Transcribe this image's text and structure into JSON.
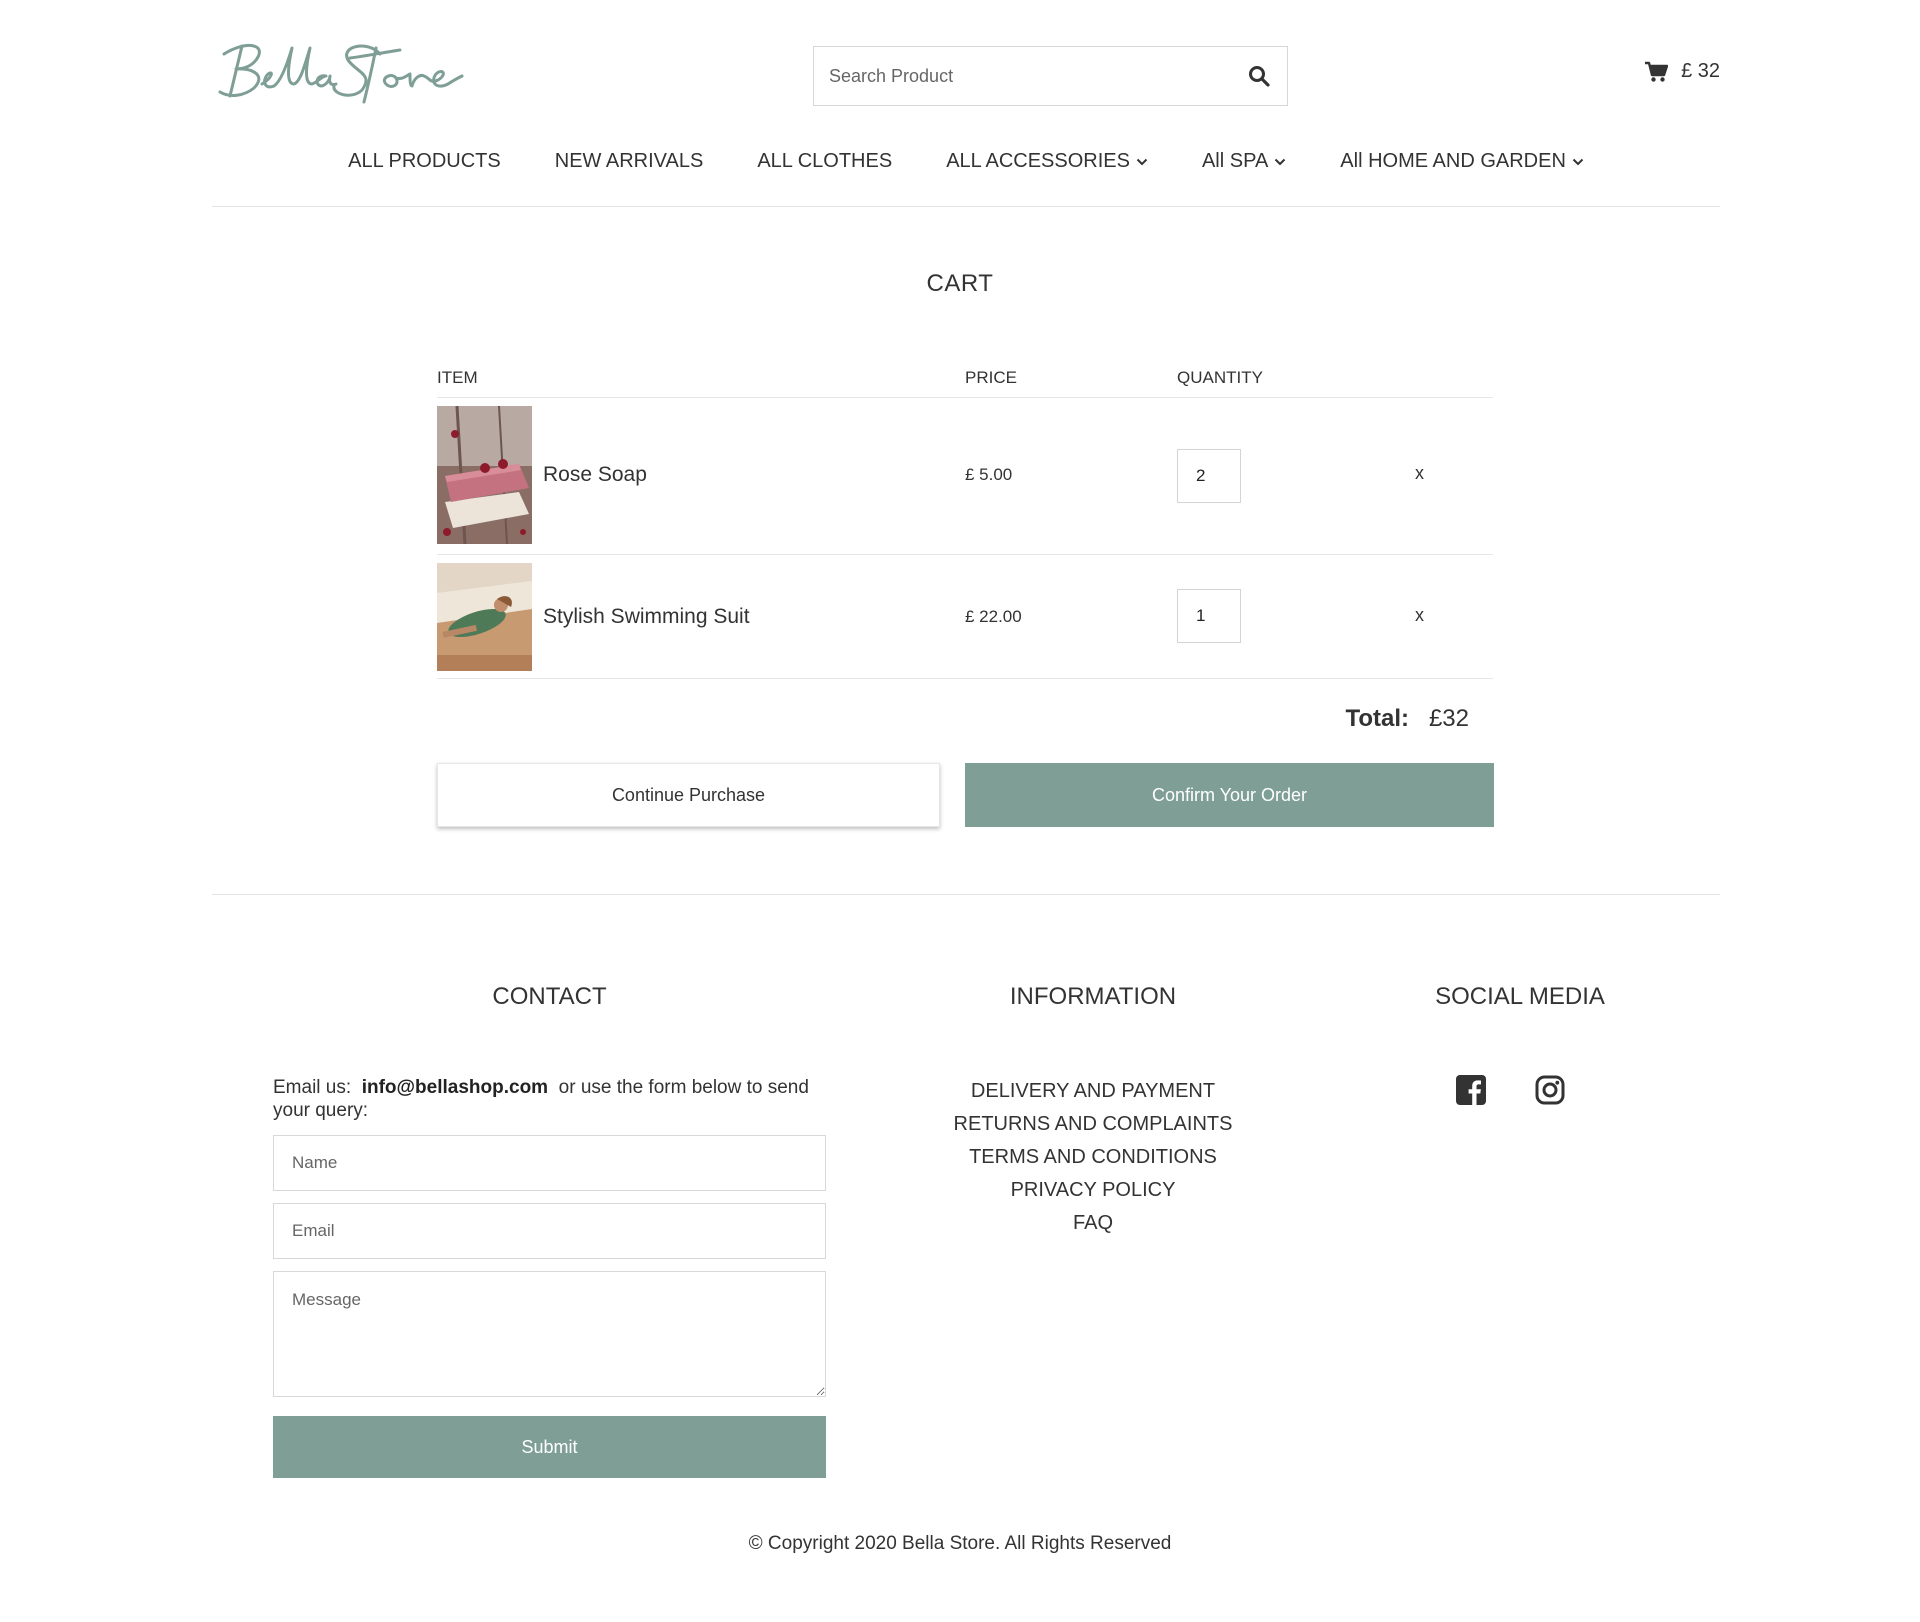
{
  "brand": {
    "logo_text": "Bella Store",
    "accent_color": "#7e9e96"
  },
  "header": {
    "search": {
      "placeholder": "Search Product"
    },
    "cart_total": "£ 32"
  },
  "nav": [
    {
      "label": "ALL PRODUCTS",
      "dropdown": false
    },
    {
      "label": "NEW ARRIVALS",
      "dropdown": false
    },
    {
      "label": "ALL CLOTHES",
      "dropdown": false
    },
    {
      "label": "ALL ACCESSORIES",
      "dropdown": true
    },
    {
      "label": "All SPA",
      "dropdown": true
    },
    {
      "label": "All HOME AND GARDEN",
      "dropdown": true
    }
  ],
  "cart": {
    "title": "CART",
    "columns": {
      "item": "ITEM",
      "price": "PRICE",
      "quantity": "QUANTITY"
    },
    "items": [
      {
        "name": "Rose Soap",
        "price": "£ 5.00",
        "quantity": "2",
        "remove": "x"
      },
      {
        "name": "Stylish Swimming Suit",
        "price": "£ 22.00",
        "quantity": "1",
        "remove": "x"
      }
    ],
    "total_label": "Total:",
    "total_value": "£32",
    "continue_label": "Continue Purchase",
    "confirm_label": "Confirm Your Order"
  },
  "footer": {
    "contact": {
      "title": "CONTACT",
      "text_before": "Email us:",
      "email": "info@bellashop.com",
      "text_after": "or use the form below to send your query:",
      "name_placeholder": "Name",
      "email_placeholder": "Email",
      "message_placeholder": "Message",
      "submit_label": "Submit"
    },
    "information": {
      "title": "INFORMATION",
      "links": [
        "DELIVERY AND PAYMENT",
        "RETURNS AND COMPLAINTS",
        "TERMS AND CONDITIONS",
        "PRIVACY POLICY",
        "FAQ"
      ]
    },
    "social": {
      "title": "SOCIAL MEDIA",
      "icons": [
        "facebook-icon",
        "instagram-icon"
      ]
    },
    "copyright": "© Copyright 2020 Bella Store. All Rights Reserved"
  }
}
